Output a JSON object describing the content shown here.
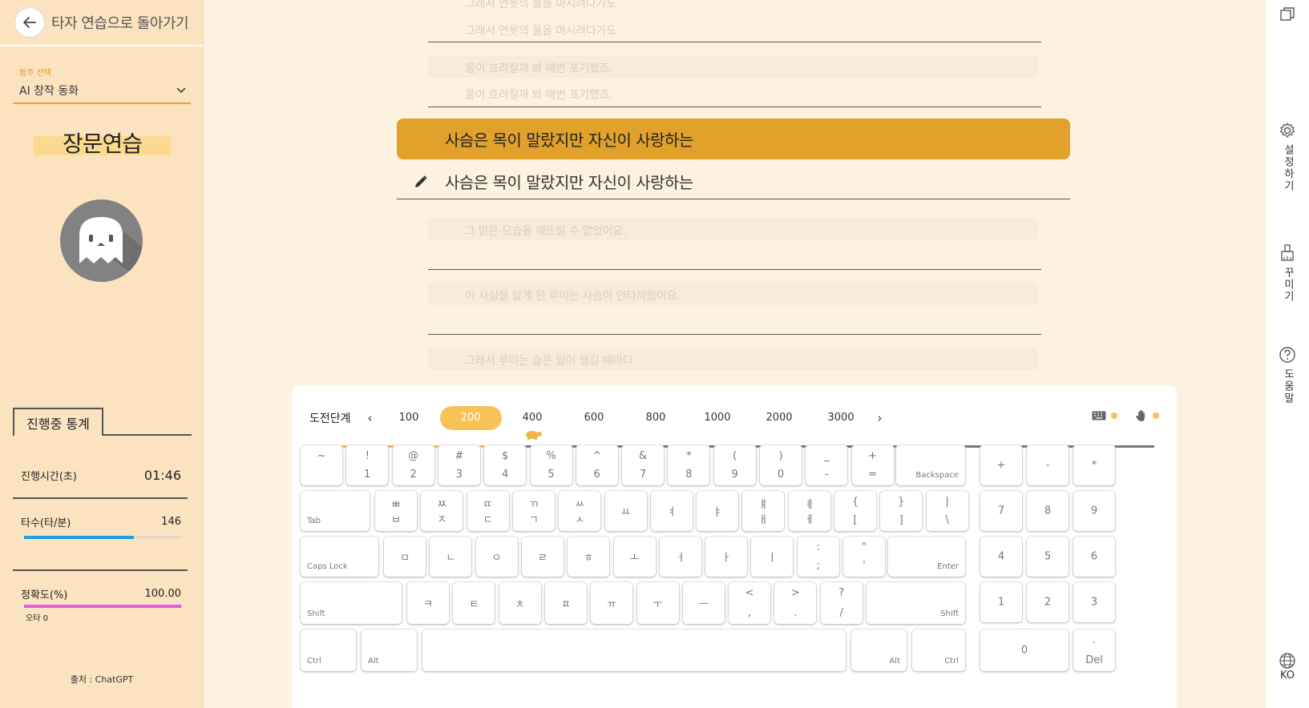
{
  "nav": {
    "back_label": "타자 연습으로 돌아가기"
  },
  "category": {
    "label": "범주 선택",
    "value": "AI 창작 동화"
  },
  "mode_title": "장문연습",
  "stats": {
    "tab_label": "진행중 통계",
    "time_label": "진행시간(초)",
    "time_value": "01:46",
    "speed_label": "타수(타/분)",
    "speed_value": "146",
    "speed_fraction": 0.7,
    "accuracy_label": "정확도(%)",
    "accuracy_value": "100.00",
    "accuracy_fraction": 1.0,
    "typo_label": "오타 0"
  },
  "source": "출처 : ChatGPT",
  "text_lines": {
    "prev1a": "그래서 연못의 물을 마시려다가도",
    "prev1b": "그래서 연못의 물을 마시려다가도",
    "prev2a": "물이 흐려질까 봐 매번 포기했죠.",
    "prev2b": "물이 흐려질까 봐 매번 포기했죠.",
    "current": "사슴은 목이 말랐지만 자신이 사랑하는",
    "typed": "사슴은 목이 말랐지만 자신이 사랑하는",
    "next1": "그 맑은 모습을 깨뜨릴 수 없었어요.",
    "next2": "이 사실을 알게 된 루미는 사슴이 안타까웠어요.",
    "next3": "그래서 루미는 슬픈 일이 생길 때마다"
  },
  "rightbar": {
    "settings": "설정하기",
    "decorate": "꾸미기",
    "help": "도움말",
    "lang": "KO"
  },
  "levels": {
    "label": "도전단계",
    "items": [
      "100",
      "200",
      "400",
      "600",
      "800",
      "1000",
      "2000",
      "3000"
    ],
    "active": "200",
    "progress_fraction": 0.253
  },
  "colors": {
    "accent": "#e1a12a",
    "speed_bar": "#1aa0e6",
    "accuracy_bar": "#e35be0"
  },
  "keys": {
    "row1": [
      [
        "~",
        ""
      ],
      [
        "!",
        "1"
      ],
      [
        "@",
        "2"
      ],
      [
        "#",
        "3"
      ],
      [
        "$",
        "4"
      ],
      [
        "%",
        "5"
      ],
      [
        "^",
        "6"
      ],
      [
        "&",
        "7"
      ],
      [
        "*",
        "8"
      ],
      [
        "(",
        "9"
      ],
      [
        ")",
        "0"
      ],
      [
        "_",
        "-"
      ],
      [
        "+",
        "="
      ]
    ],
    "backspace": "Backspace",
    "tab": "Tab",
    "row2": [
      [
        "ㅃ",
        "ㅂ"
      ],
      [
        "ㅉ",
        "ㅈ"
      ],
      [
        "ㄸ",
        "ㄷ"
      ],
      [
        "ㄲ",
        "ㄱ"
      ],
      [
        "ㅆ",
        "ㅅ"
      ],
      [
        "",
        "ㅛ"
      ],
      [
        "",
        "ㅕ"
      ],
      [
        "",
        "ㅑ"
      ],
      [
        "ㅒ",
        "ㅐ"
      ],
      [
        "ㅖ",
        "ㅔ"
      ],
      [
        "{",
        "["
      ],
      [
        "}",
        "]"
      ],
      [
        "|",
        "\\"
      ]
    ],
    "capslock": "Caps Lock",
    "row3": [
      [
        "",
        "ㅁ"
      ],
      [
        "",
        "ㄴ"
      ],
      [
        "",
        "ㅇ"
      ],
      [
        "",
        "ㄹ"
      ],
      [
        "",
        "ㅎ"
      ],
      [
        "",
        "ㅗ"
      ],
      [
        "",
        "ㅓ"
      ],
      [
        "",
        "ㅏ"
      ],
      [
        "",
        "ㅣ"
      ],
      [
        ":",
        ";"
      ],
      [
        "\"",
        "'"
      ]
    ],
    "enter": "Enter",
    "shift": "Shift",
    "row4": [
      [
        "",
        "ㅋ"
      ],
      [
        "",
        "ㅌ"
      ],
      [
        "",
        "ㅊ"
      ],
      [
        "",
        "ㅍ"
      ],
      [
        "",
        "ㅠ"
      ],
      [
        "",
        "ㅜ"
      ],
      [
        "",
        "ㅡ"
      ],
      [
        "<",
        ","
      ],
      [
        ">",
        "."
      ],
      [
        "?",
        "/"
      ]
    ],
    "ctrl": "Ctrl",
    "alt": "Alt",
    "numpad_top": [
      "+",
      "-",
      "*"
    ],
    "numpad": [
      [
        "7",
        "8",
        "9"
      ],
      [
        "4",
        "5",
        "6"
      ],
      [
        "1",
        "2",
        "3"
      ]
    ],
    "num0": "0",
    "del_top": ".",
    "del": "Del"
  }
}
